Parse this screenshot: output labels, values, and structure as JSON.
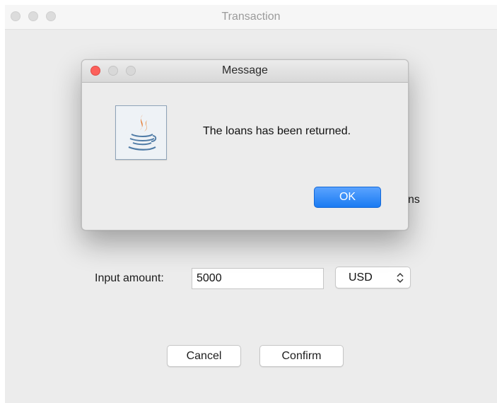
{
  "window": {
    "title": "Transaction"
  },
  "form": {
    "obscured_label_tail": "ns",
    "amount_label": "Input amount:",
    "amount_value": "5000",
    "currency_selected": "USD",
    "cancel_label": "Cancel",
    "confirm_label": "Confirm"
  },
  "dialog": {
    "title": "Message",
    "message": "The loans has been returned.",
    "ok_label": "OK",
    "icon": "java-icon"
  },
  "colors": {
    "accent": "#1a7bf2",
    "close_red": "#fc605b"
  }
}
